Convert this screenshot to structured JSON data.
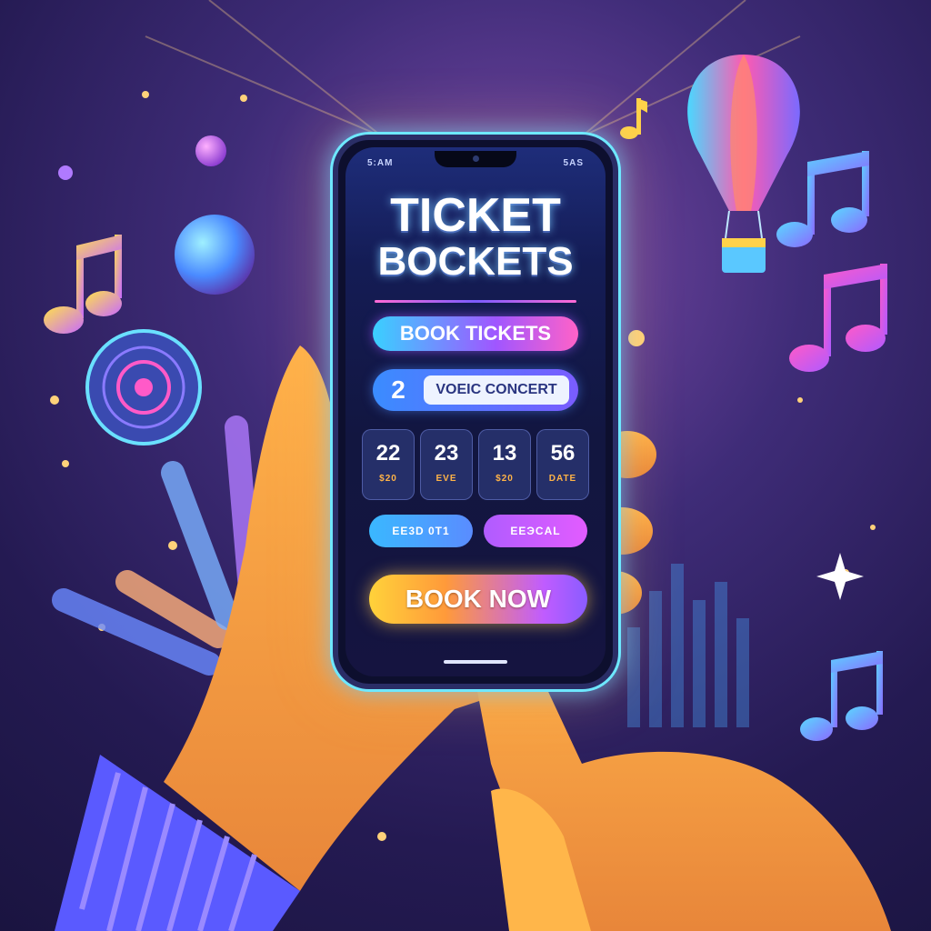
{
  "app": {
    "title_line1": "TICKET",
    "title_line2": "BOCKETS"
  },
  "status_bar": {
    "left": "5:AM",
    "right": "5AS"
  },
  "book_tickets": {
    "label": "BOOK TICKETS"
  },
  "concert": {
    "count": "2",
    "name": "VOEIC CONCERT"
  },
  "dates": [
    {
      "day": "22",
      "sub": "$20"
    },
    {
      "day": "23",
      "sub": "EVE"
    },
    {
      "day": "13",
      "sub": "$20"
    },
    {
      "day": "56",
      "sub": "DATE"
    }
  ],
  "chips": {
    "left": "EE3D 0T1",
    "right": "ЕЕЭСAL"
  },
  "cta": {
    "label": "BOOK NOW"
  },
  "colors": {
    "accent_cyan": "#3ad0ff",
    "accent_purple": "#a056ff",
    "accent_pink": "#ff62c8",
    "accent_yellow": "#ffd23a",
    "background": "#2b1f5e"
  },
  "icons": [
    "music-note-icon",
    "hot-air-balloon-icon",
    "vinyl-disc-icon",
    "sparkle-icon",
    "sphere-icon"
  ]
}
